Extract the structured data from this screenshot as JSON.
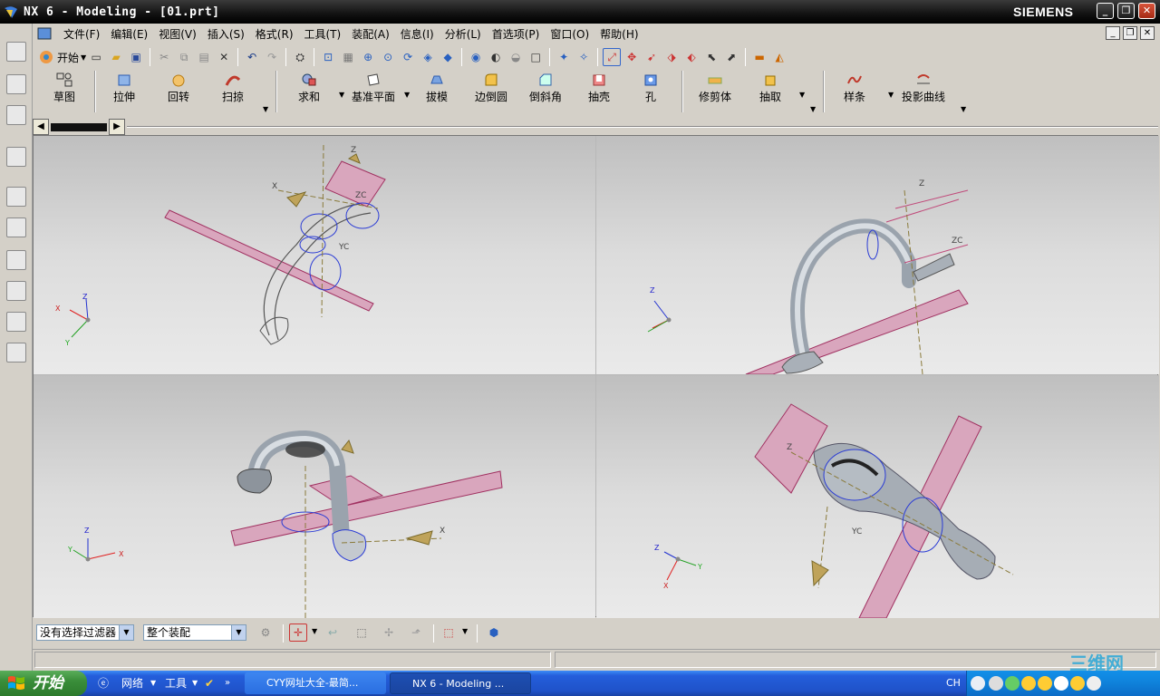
{
  "window": {
    "title": "NX 6 - Modeling - [01.prt]",
    "brand": "SIEMENS",
    "controls": {
      "minimize": "_",
      "restore": "❐",
      "close": "✕"
    }
  },
  "menu": [
    "文件(F)",
    "编辑(E)",
    "视图(V)",
    "插入(S)",
    "格式(R)",
    "工具(T)",
    "装配(A)",
    "信息(I)",
    "分析(L)",
    "首选项(P)",
    "窗口(O)",
    "帮助(H)"
  ],
  "standard_toolbar": {
    "start_label": "开始"
  },
  "feature_toolbar": [
    {
      "label": "草图",
      "icon": "sketch-icon"
    },
    {
      "label": "拉伸",
      "icon": "extrude-icon"
    },
    {
      "label": "回转",
      "icon": "revolve-icon"
    },
    {
      "label": "扫掠",
      "icon": "sweep-icon"
    },
    {
      "label": "求和",
      "icon": "unite-icon"
    },
    {
      "label": "基准平面",
      "icon": "datum-plane-icon"
    },
    {
      "label": "拔模",
      "icon": "draft-icon"
    },
    {
      "label": "边倒圆",
      "icon": "edge-blend-icon"
    },
    {
      "label": "倒斜角",
      "icon": "chamfer-icon"
    },
    {
      "label": "抽壳",
      "icon": "shell-icon"
    },
    {
      "label": "孔",
      "icon": "hole-icon"
    },
    {
      "label": "修剪体",
      "icon": "trim-body-icon"
    },
    {
      "label": "抽取",
      "icon": "extract-icon"
    },
    {
      "label": "样条",
      "icon": "spline-icon"
    },
    {
      "label": "投影曲线",
      "icon": "project-curve-icon"
    }
  ],
  "viewport": {
    "triad_labels": {
      "x": "X",
      "y": "Y",
      "z": "Z"
    },
    "wcs_labels": {
      "xc": "XC",
      "yc": "YC",
      "zc": "ZC"
    }
  },
  "selection_bar": {
    "filter_value": "没有选择过滤器",
    "scope_value": "整个装配"
  },
  "taskbar": {
    "start": "开始",
    "quicklaunch": [
      "网络",
      "工具"
    ],
    "tasks": [
      "CYY网址大全-最简...",
      "NX 6 - Modeling ..."
    ],
    "tray_lang": "CH"
  },
  "watermark": "三维网"
}
